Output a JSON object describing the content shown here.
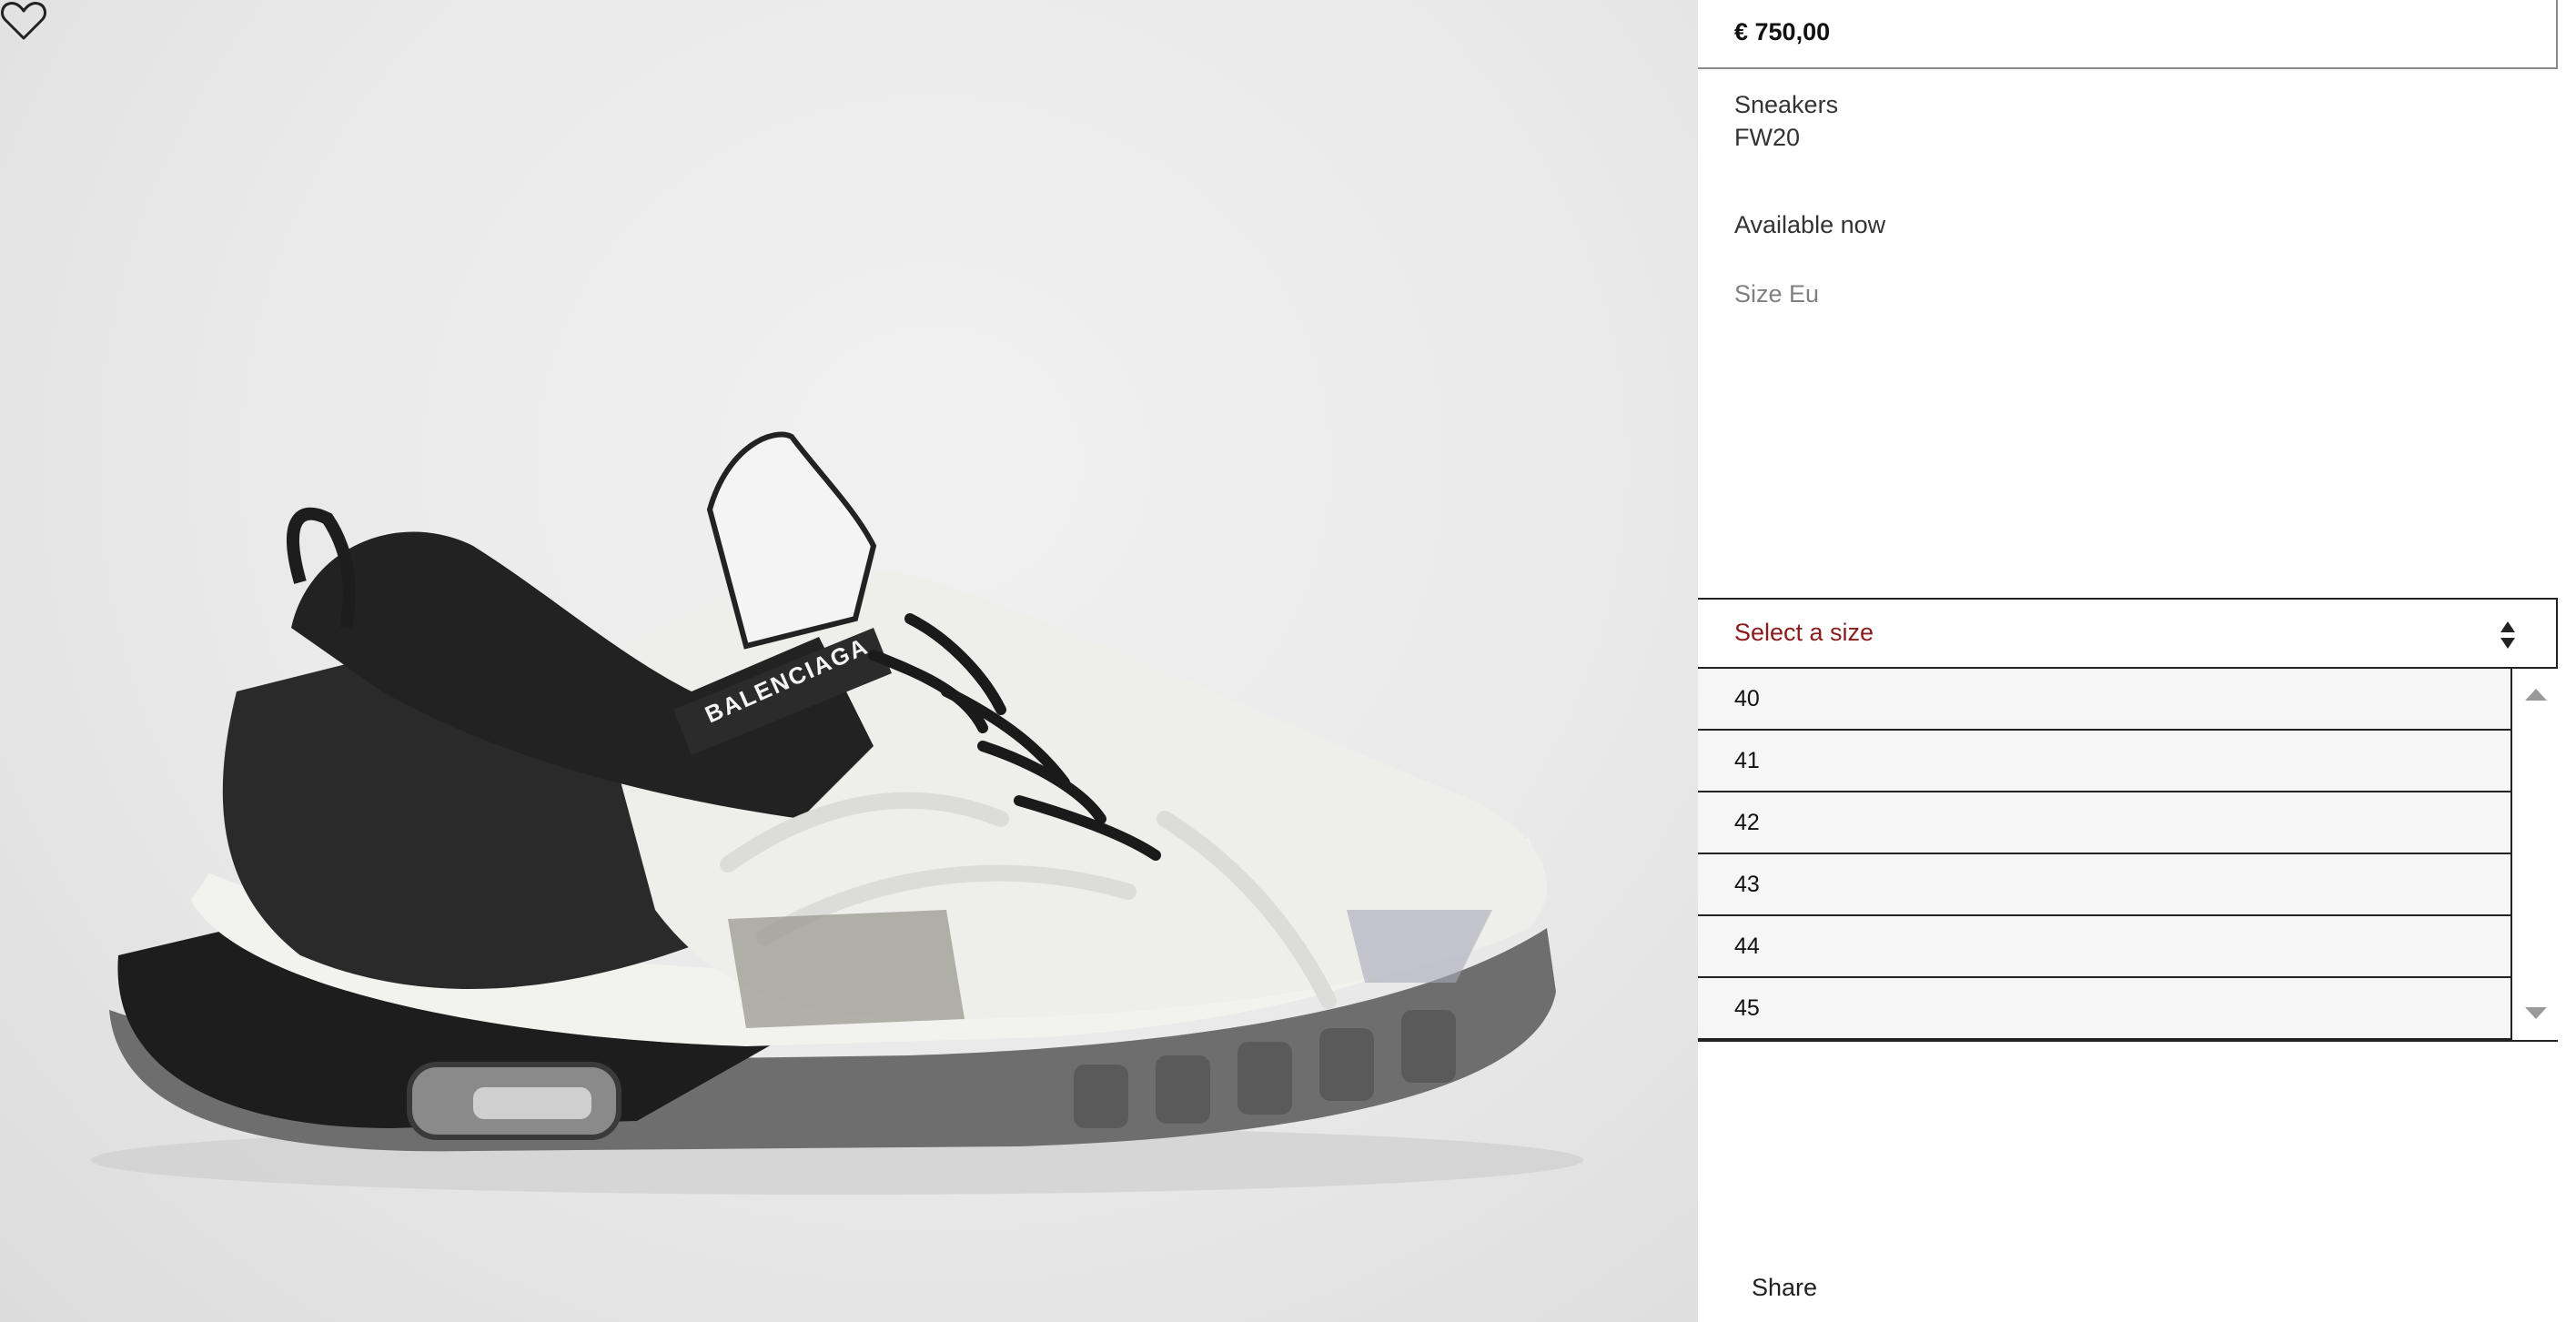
{
  "product": {
    "price": "€ 750,00",
    "category": "Sneakers",
    "season": "FW20",
    "availability": "Available now",
    "image_brand_text": "BALENCIAGA"
  },
  "size": {
    "label": "Size Eu",
    "placeholder": "Select a size",
    "options": [
      "40",
      "41",
      "42",
      "43",
      "44",
      "45"
    ]
  },
  "actions": {
    "share_label": "Share"
  },
  "colors": {
    "placeholder_text": "#8b1a1a",
    "background_photo": "#e9e9e9",
    "option_background": "#f6f6f6"
  },
  "icons": [
    "heart-icon",
    "select-arrows-icon",
    "scroll-up-icon",
    "scroll-down-icon"
  ]
}
